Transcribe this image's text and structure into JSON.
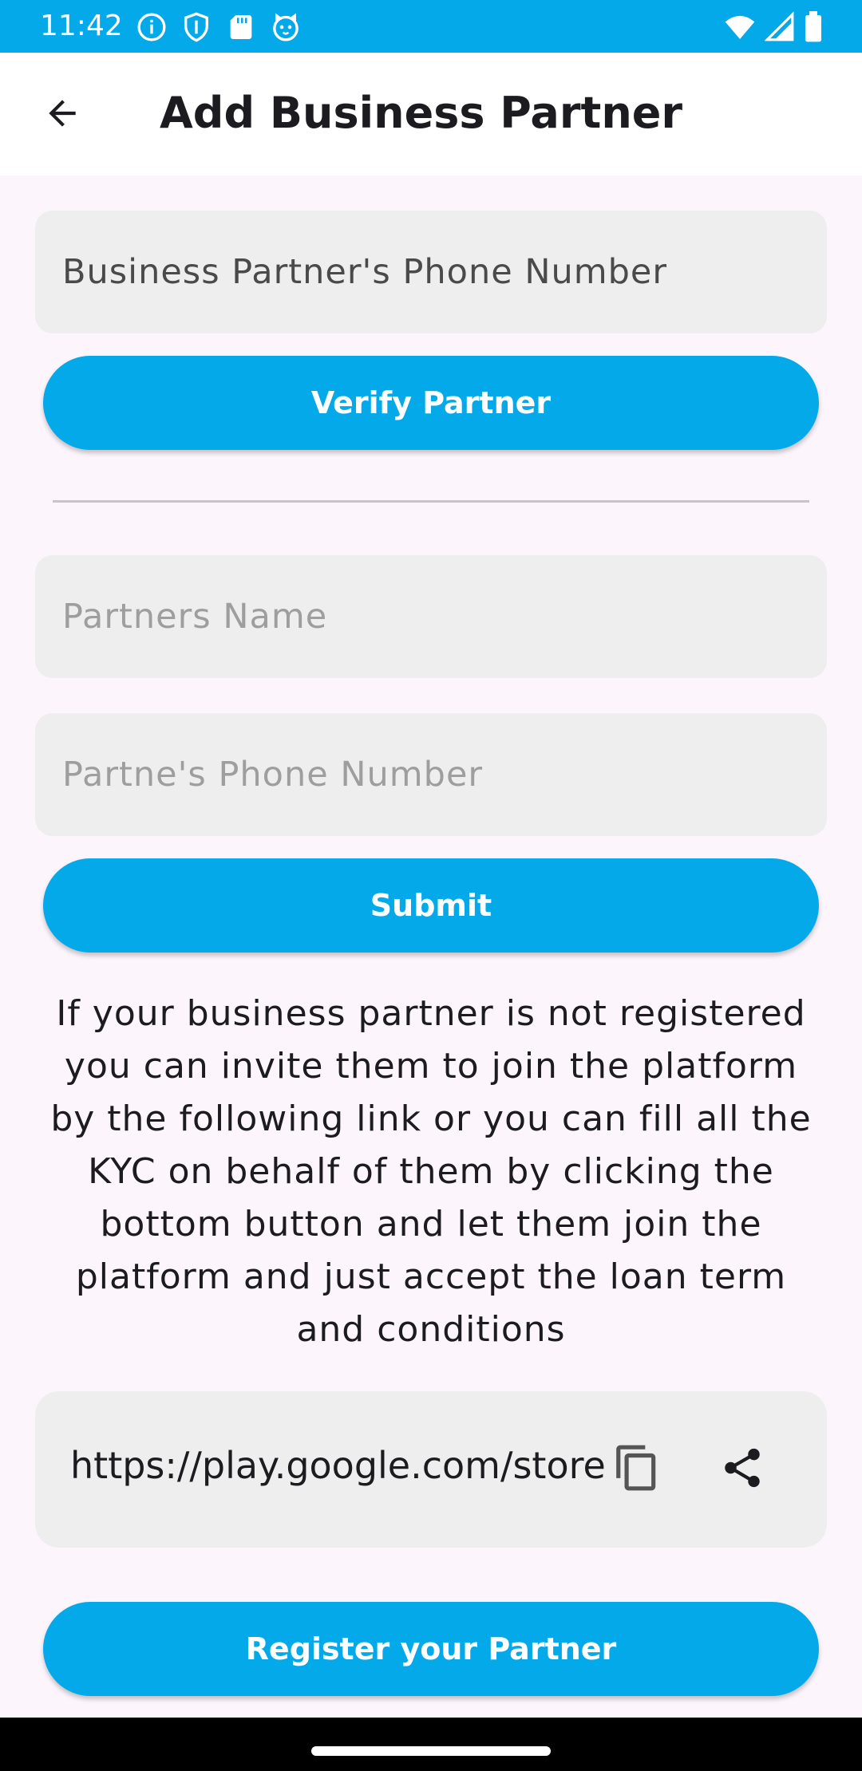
{
  "status_bar": {
    "time": "11:42",
    "left_icons": [
      "info-icon",
      "shield-icon",
      "sd-card-icon",
      "cat-icon"
    ],
    "right_icons": [
      "wifi-icon",
      "signal-icon",
      "battery-icon"
    ],
    "background": "#03a9e8"
  },
  "app_bar": {
    "back_icon": "arrow-back-icon",
    "title": "Add Business Partner"
  },
  "verify_section": {
    "phone_field": {
      "value": "",
      "placeholder": "Business Partner's Phone Number"
    },
    "verify_button_label": "Verify Partner"
  },
  "manual_section": {
    "name_field": {
      "value": "",
      "placeholder": "Partners Name"
    },
    "phone_field": {
      "value": "",
      "placeholder": "Partne's Phone Number"
    },
    "submit_button_label": "Submit"
  },
  "info_text": "If your business partner is not registered you can invite them to join the platform by the following link or you can fill all the KYC on behalf of them by clicking the bottom button and let them join the platform and just accept the loan term and conditions",
  "invite_link": {
    "url": "https://play.google.com/store",
    "copy_icon": "copy-icon",
    "share_icon": "share-icon"
  },
  "register_button_label": "Register your Partner",
  "colors": {
    "accent": "#03a9e8",
    "page_background": "#fcf5fc",
    "field_background": "#eeeeee"
  }
}
